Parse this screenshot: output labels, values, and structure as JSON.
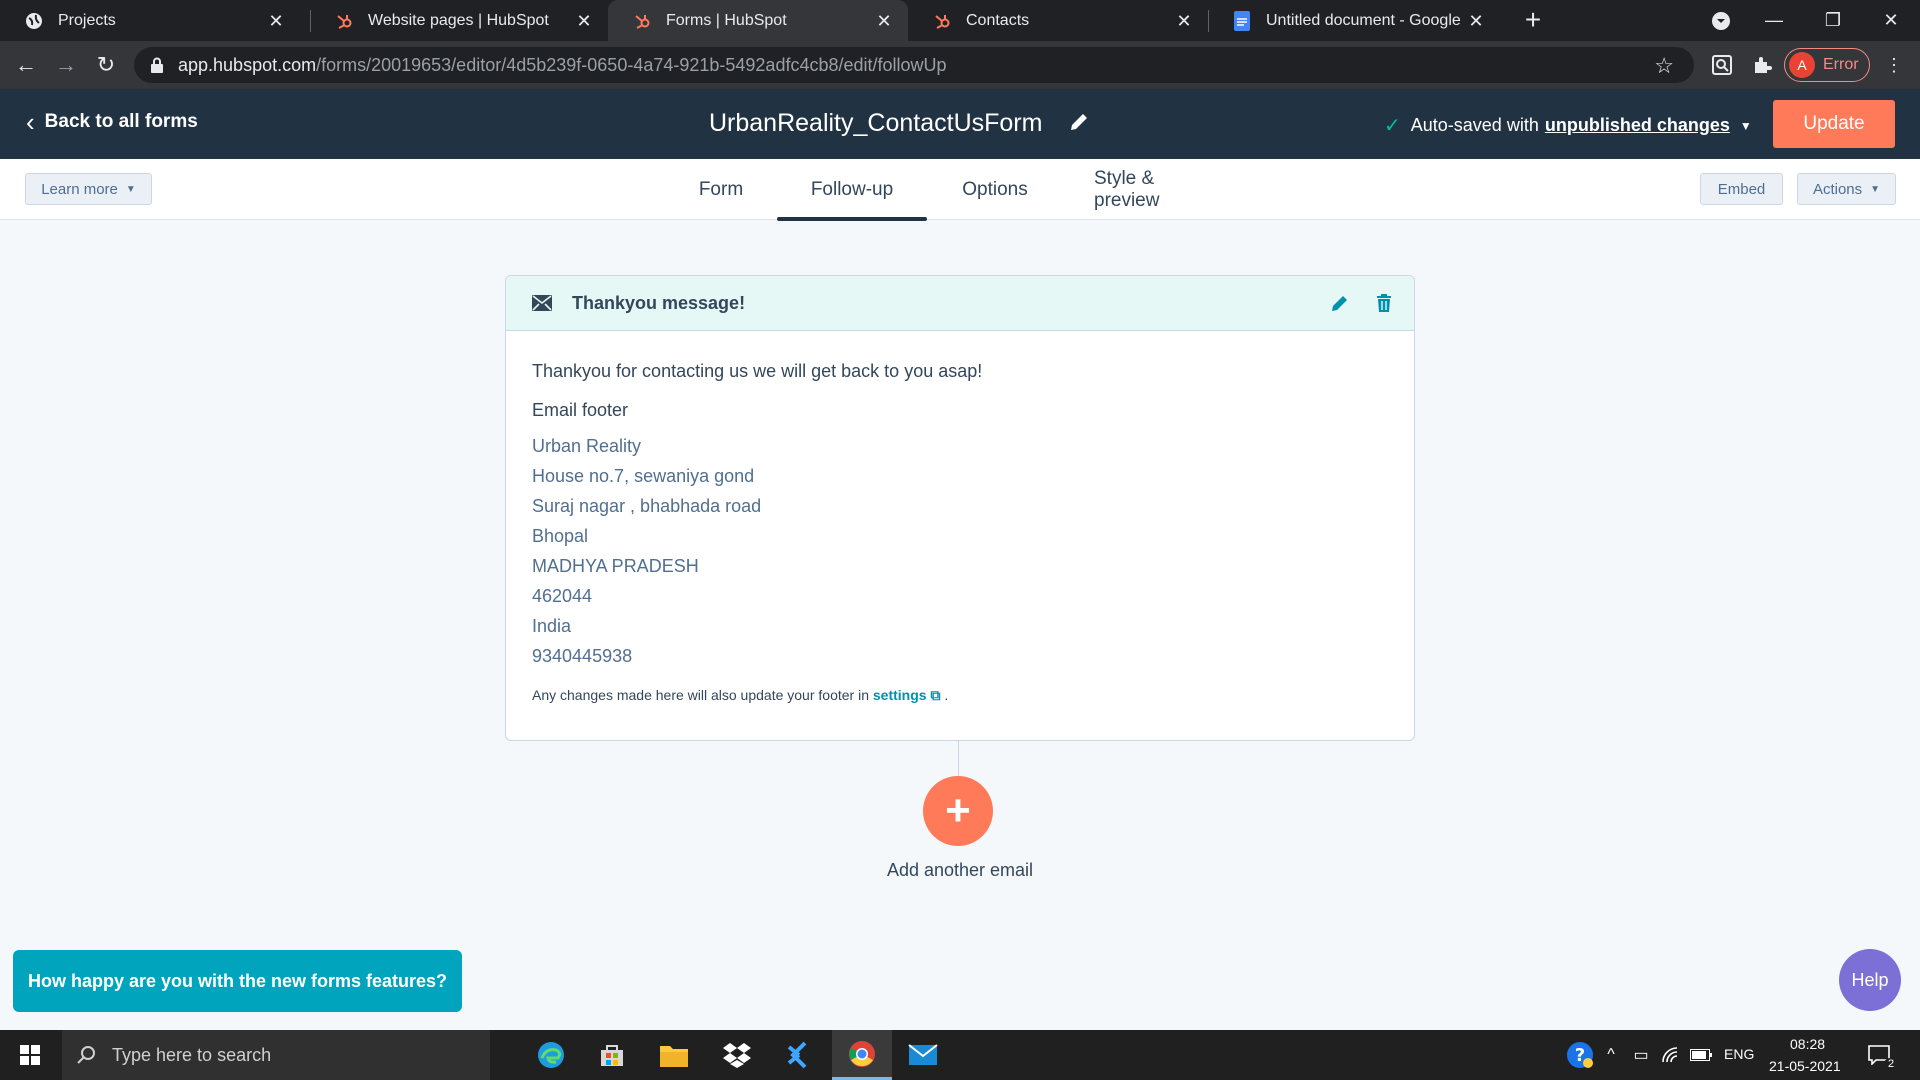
{
  "browser": {
    "tabs": [
      {
        "title": "Projects",
        "icon": "globe-icon",
        "active": false
      },
      {
        "title": "Website pages | HubSpot",
        "icon": "hubspot-icon",
        "active": false
      },
      {
        "title": "Forms | HubSpot",
        "icon": "hubspot-icon",
        "active": true
      },
      {
        "title": "Contacts",
        "icon": "hubspot-icon",
        "active": false
      },
      {
        "title": "Untitled document - Google Doc",
        "icon": "google-docs-icon",
        "active": false
      }
    ],
    "url_host": "app.hubspot.com",
    "url_path": "/forms/20019653/editor/4d5b239f-0650-4a74-921b-5492adfc4cb8/edit/followUp",
    "profile_initial": "A",
    "profile_status": "Error"
  },
  "header": {
    "back_label": "Back to all forms",
    "form_title": "UrbanReality_ContactUsForm",
    "autosave_prefix": "Auto-saved with",
    "autosave_link": "unpublished changes",
    "update_label": "Update"
  },
  "tabbar": {
    "learn_more": "Learn more",
    "tabs": [
      "Form",
      "Follow-up",
      "Options",
      "Style & preview"
    ],
    "active_tab": "Follow-up",
    "embed": "Embed",
    "actions": "Actions"
  },
  "email_card": {
    "title": "Thankyou message!",
    "message": "Thankyou for contacting us we will get back to you asap!",
    "footer_heading": "Email footer",
    "footer_lines": [
      "Urban Reality",
      "House no.7, sewaniya gond",
      "Suraj nagar , bhabhada road",
      "Bhopal",
      "MADHYA PRADESH",
      "462044",
      "India",
      "9340445938"
    ],
    "note_prefix": "Any changes made here will also update your footer in",
    "note_link": "settings",
    "note_suffix": "."
  },
  "add_email_label": "Add another email",
  "survey_label": "How happy are you with the new forms features?",
  "help_label": "Help",
  "taskbar": {
    "search_placeholder": "Type here to search",
    "language": "ENG",
    "time": "08:28",
    "date": "21-05-2021",
    "notification_count": "2"
  },
  "colors": {
    "hubspot_navy": "#213343",
    "hubspot_orange": "#ff7a59",
    "teal": "#00a4bd",
    "card_header": "#e5f8f6",
    "help_purple": "#7c6fd6"
  }
}
